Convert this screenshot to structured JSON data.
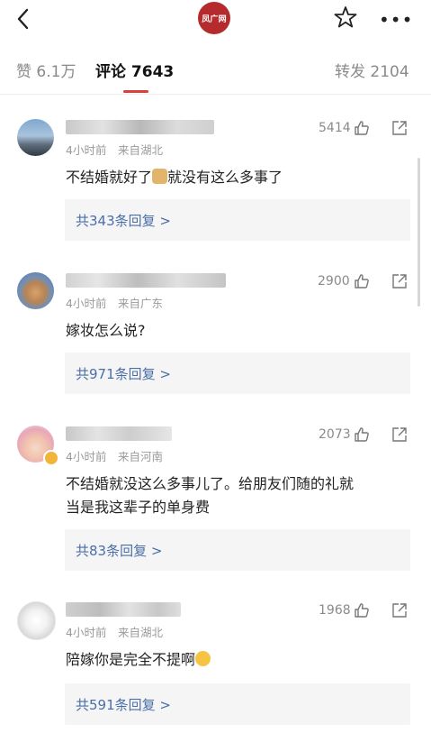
{
  "header": {
    "logo_text": "凤广网"
  },
  "tabs": {
    "likes": "赞 6.1万",
    "comments": "评论 7643",
    "reposts": "转发 2104"
  },
  "comments": [
    {
      "meta": "4小时前　来自湖北",
      "likes": "5414",
      "text_before": "不结婚就好了",
      "emoji": "doge",
      "text_after": "就没有这么多事了",
      "replies": "共343条回复 >"
    },
    {
      "meta": "4小时前　来自广东",
      "likes": "2900",
      "text": "嫁妆怎么说?",
      "replies": "共971条回复 >"
    },
    {
      "meta": "4小时前　来自河南",
      "likes": "2073",
      "text_line1": "不结婚就没这么多事儿了。给朋友们随的礼就",
      "text_line2": "当是我这辈子的单身费",
      "replies": "共83条回复 >"
    },
    {
      "meta": "4小时前　来自湖北",
      "likes": "1968",
      "text_before": "陪嫁你是完全不提啊",
      "emoji": "fearful",
      "replies": "共591条回复 >"
    }
  ]
}
